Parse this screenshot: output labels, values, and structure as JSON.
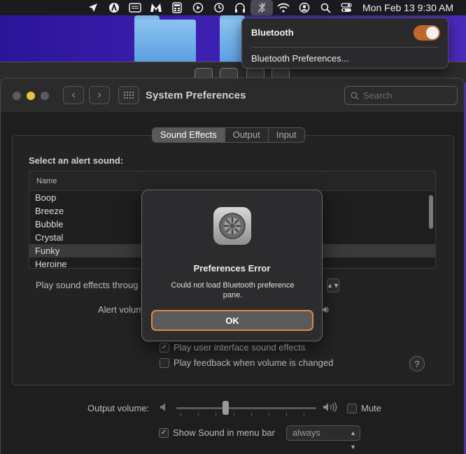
{
  "menubar": {
    "icons": [
      "location-arrow-icon",
      "astro-icon",
      "window-icon",
      "malwarebytes-icon",
      "calculator-icon",
      "play-icon",
      "history-icon",
      "headphones-icon",
      "bluetooth-icon",
      "wifi-icon",
      "user-icon",
      "search-icon",
      "control-center-icon"
    ],
    "datetime": "Mon Feb 13  9:30 AM"
  },
  "bluetooth_menu": {
    "title": "Bluetooth",
    "toggle_on": true,
    "preferences_label": "Bluetooth Preferences..."
  },
  "window": {
    "title": "System Preferences",
    "search_placeholder": "Search"
  },
  "tabs": [
    "Sound Effects",
    "Output",
    "Input"
  ],
  "sound_effects": {
    "select_label": "Select an alert sound:",
    "column_header": "Name",
    "sounds": [
      "Boop",
      "Breeze",
      "Bubble",
      "Crystal",
      "Funky",
      "Heroine"
    ],
    "selected_sound": "Funky",
    "play_through_label": "Play sound effects throug",
    "alert_volume_label": "Alert volum",
    "ui_sounds_label": "Play user interface sound effects",
    "ui_sounds_checked": true,
    "feedback_label": "Play feedback when volume is changed",
    "feedback_checked": false,
    "help_label": "?"
  },
  "output_volume": {
    "label": "Output volume:",
    "level": 0.35,
    "mute_label": "Mute",
    "mute_checked": false
  },
  "show_in_menubar": {
    "label": "Show Sound in menu bar",
    "checked": true,
    "option": "always"
  },
  "dialog": {
    "title": "Preferences Error",
    "message": "Could not load Bluetooth preference pane.",
    "ok_label": "OK"
  }
}
